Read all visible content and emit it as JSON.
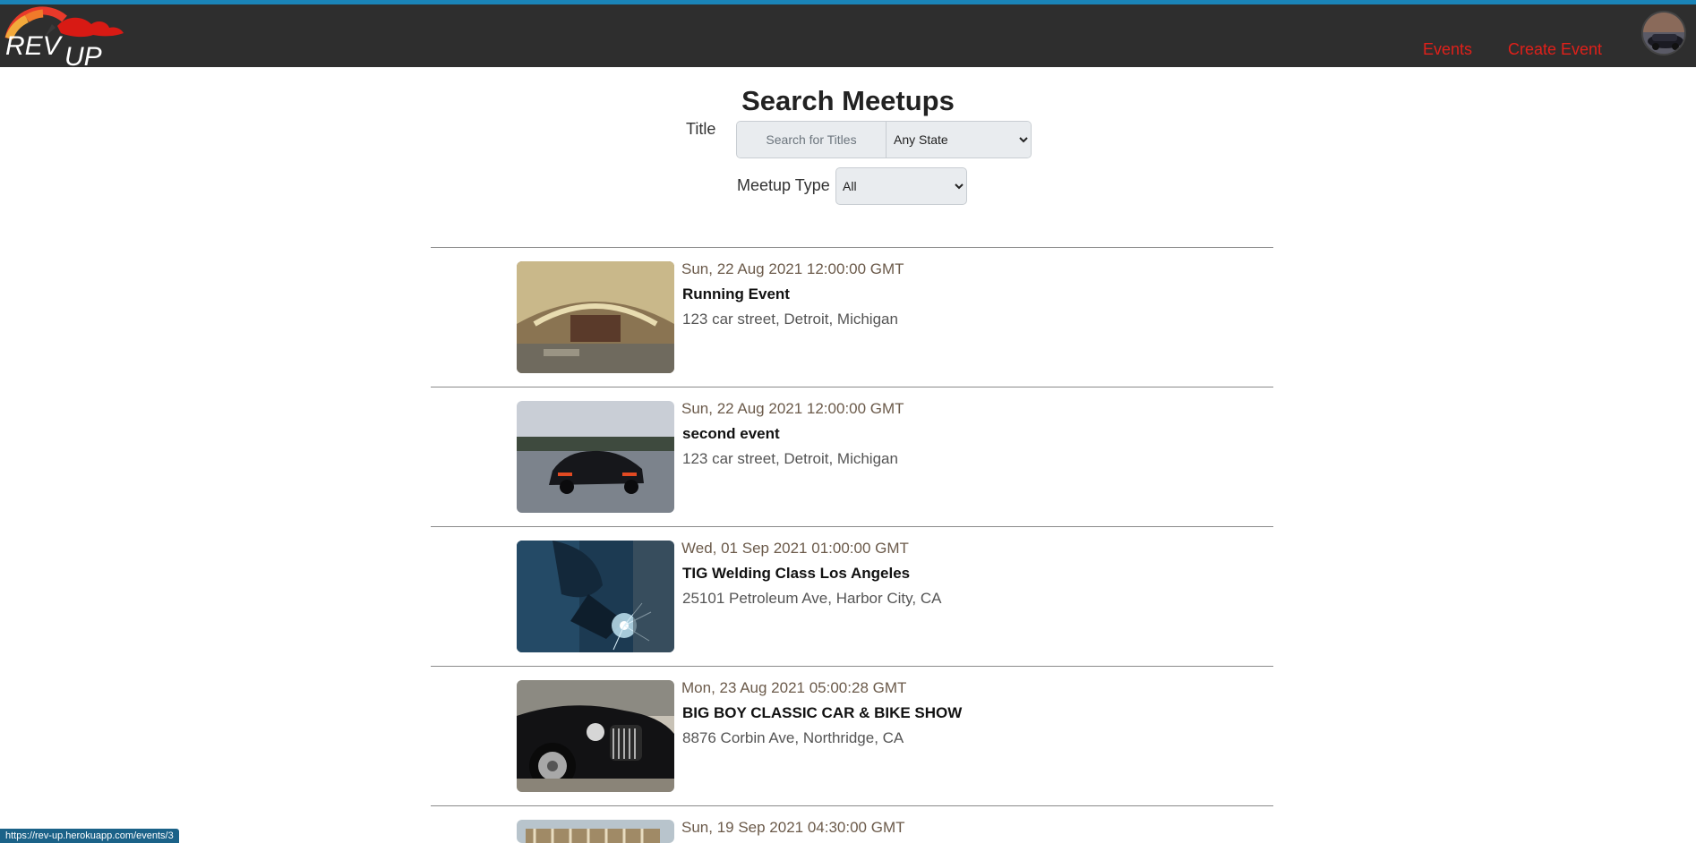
{
  "header": {
    "logo_text": "REVUP",
    "nav": {
      "events": "Events",
      "create_event": "Create Event"
    }
  },
  "search": {
    "heading": "Search Meetups",
    "title_label": "Title",
    "title_placeholder": "Search for Titles",
    "state_selected": "Any State",
    "type_label": "Meetup Type",
    "type_selected": "All"
  },
  "events": [
    {
      "date": "Sun, 22 Aug 2021 12:00:00 GMT",
      "title": "Running Event",
      "address": "123 car street, Detroit, Michigan",
      "image": "abandoned-theater-photo"
    },
    {
      "date": "Sun, 22 Aug 2021 12:00:00 GMT",
      "title": "second event",
      "address": "123 car street, Detroit, Michigan",
      "image": "black-sports-car-photo"
    },
    {
      "date": "Wed, 01 Sep 2021 01:00:00 GMT",
      "title": "TIG Welding Class Los Angeles",
      "address": "25101 Petroleum Ave, Harbor City, CA",
      "image": "welder-sparks-photo"
    },
    {
      "date": "Mon, 23 Aug 2021 05:00:28 GMT",
      "title": "BIG BOY CLASSIC CAR & BIKE SHOW",
      "address": "8876 Corbin Ave, Northridge, CA",
      "image": "classic-car-photo"
    },
    {
      "date": "Sun, 19 Sep 2021 04:30:00 GMT",
      "title": "",
      "address": "",
      "image": "building-photo"
    }
  ],
  "status_bar": {
    "url": "https://rev-up.herokuapp.com/events/3"
  },
  "colors": {
    "accent": "#e0201a",
    "header_bg": "#2e2e2e",
    "top_border": "#1a84b8"
  }
}
